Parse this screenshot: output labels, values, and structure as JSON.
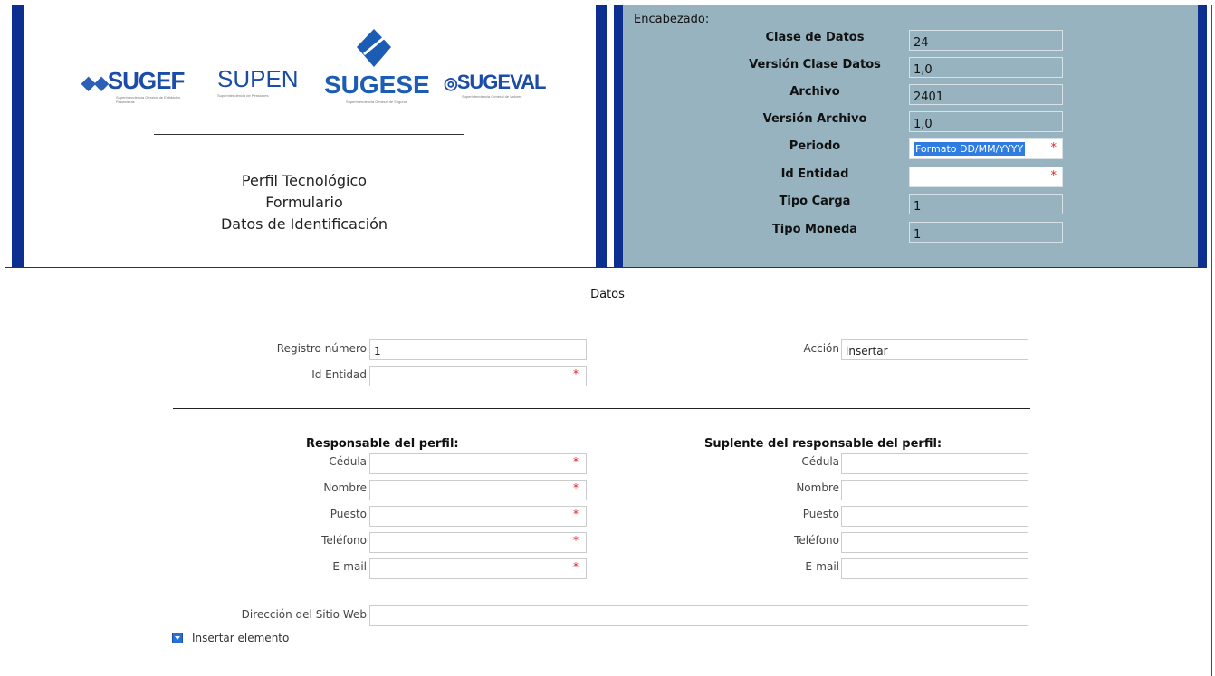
{
  "header_left": {
    "logos": [
      {
        "name": "SUGEF",
        "sub": "Superintendencia General de Entidades Financieras"
      },
      {
        "name": "SUPEN",
        "sub": "Superintendencia de Pensiones"
      },
      {
        "name": "SUGESE",
        "sub": "Superintendencia General de Seguros"
      },
      {
        "name": "SUGEVAL",
        "sub": "Superintendencia General de Valores"
      }
    ],
    "title1": "Perfil Tecnológico",
    "title2": "Formulario",
    "title3": "Datos de Identificación"
  },
  "header_right": {
    "title": "Encabezado:",
    "rows": [
      {
        "label": "Clase de Datos",
        "value": "24"
      },
      {
        "label": "Versión Clase Datos",
        "value": "1,0"
      },
      {
        "label": "Archivo",
        "value": "2401"
      },
      {
        "label": "Versión Archivo",
        "value": "1,0"
      },
      {
        "label": "Periodo",
        "value": "Formato DD/MM/YYYY"
      },
      {
        "label": "Id Entidad",
        "value": ""
      },
      {
        "label": "Tipo Carga",
        "value": "1"
      },
      {
        "label": "Tipo Moneda",
        "value": "1"
      }
    ],
    "required_mark": "*"
  },
  "datos": {
    "title": "Datos",
    "registro_label": "Registro número",
    "registro_value": "1",
    "accion_label": "Acción",
    "accion_value": "insertar",
    "id_entidad_label": "Id Entidad",
    "id_entidad_value": ""
  },
  "responsable": {
    "title": "Responsable del perfil:",
    "fields": [
      "Cédula",
      "Nombre",
      "Puesto",
      "Teléfono",
      "E-mail"
    ]
  },
  "suplente": {
    "title": "Suplente del responsable del perfil:",
    "fields": [
      "Cédula",
      "Nombre",
      "Puesto",
      "Teléfono",
      "E-mail"
    ]
  },
  "web": {
    "label": "Dirección del Sitio Web",
    "value": ""
  },
  "insert_label": "Insertar elemento",
  "colors": {
    "header_bg": "#96b3bf",
    "accent_bar": "#0d2f8f",
    "required": "#e02020"
  }
}
